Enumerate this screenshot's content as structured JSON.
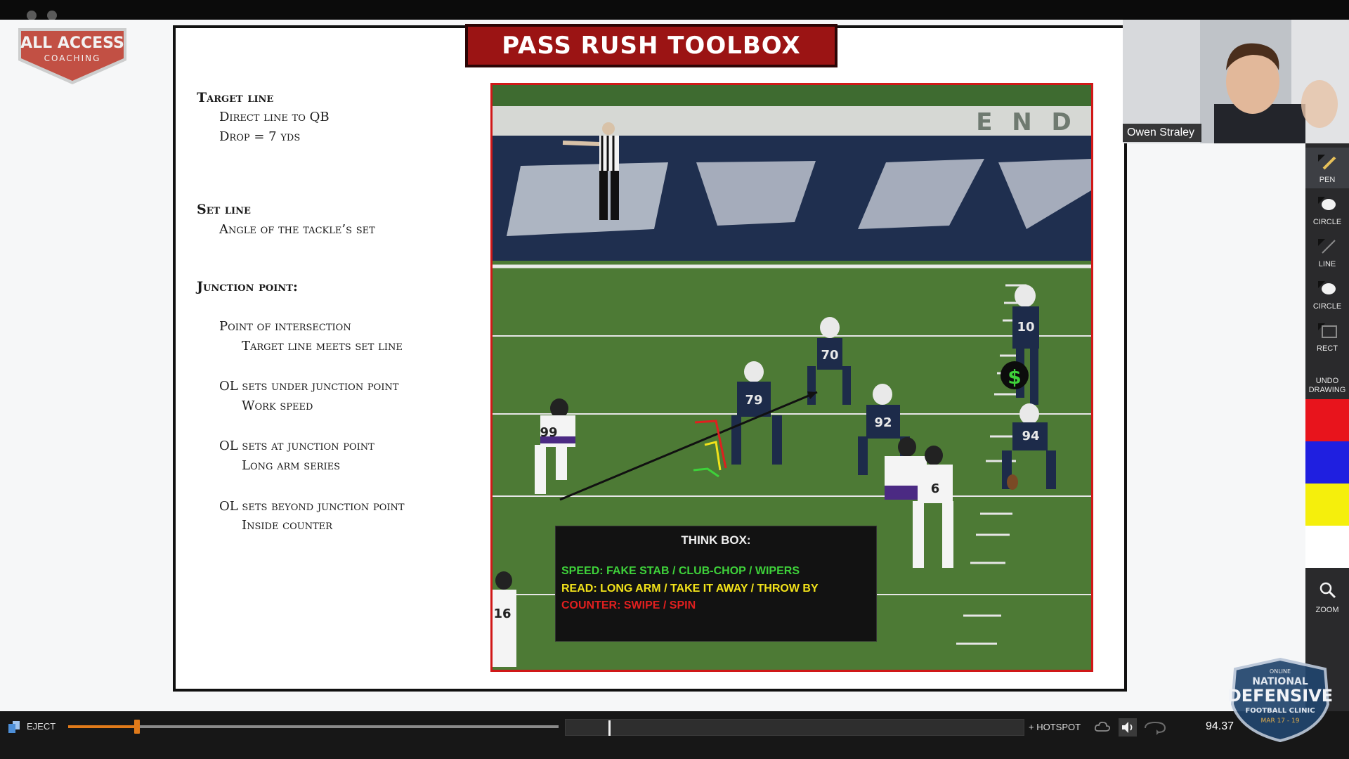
{
  "brand": {
    "logo_line1": "ALL ACCESS",
    "logo_line2": "COACHING",
    "logo_color": "#c0392b"
  },
  "slide": {
    "title": "PASS RUSH TOOLBOX",
    "title_bg": "#9b1414",
    "notes": {
      "target_line": "Target line",
      "target_sub1": "Direct line to QB",
      "target_sub2": "Drop = 7 yds",
      "set_line": "Set line",
      "set_sub1": "Angle of the tackle’s set",
      "junction": "Junction point:",
      "junction_sub1": "Point of intersection",
      "junction_sub1b": "Target line meets set line",
      "under": "OL sets under junction point",
      "under_sub": "Work speed",
      "at": "OL sets at junction point",
      "at_sub": "Long arm series",
      "beyond": "OL sets beyond junction point",
      "beyond_sub": "Inside counter"
    },
    "field": {
      "endzone_text": "E N D",
      "jersey_numbers": [
        "10",
        "70",
        "79",
        "92",
        "94",
        "99",
        "6",
        "16"
      ],
      "money_icon": "$",
      "colors": {
        "grass": "#4d7a35",
        "chargers": "#1d2b4a",
        "ravens": "#ffffff",
        "ravens_accent": "#4b2a83"
      }
    },
    "think_box": {
      "title": "THINK BOX:",
      "speed": "SPEED: FAKE STAB / CLUB-CHOP / WIPERS",
      "read": "READ: LONG ARM / TAKE IT AWAY / THROW BY",
      "counter": "COUNTER: SWIPE / SPIN",
      "speed_color": "#3ed13a",
      "read_color": "#f2e21a",
      "counter_color": "#e01f1f"
    }
  },
  "webcam": {
    "name": "Owen Straley"
  },
  "tools": {
    "items": [
      {
        "label": "PEN",
        "icon": "pen-icon"
      },
      {
        "label": "CIRCLE",
        "icon": "circle-icon"
      },
      {
        "label": "LINE",
        "icon": "line-icon"
      },
      {
        "label": "CIRCLE",
        "icon": "circle-icon"
      },
      {
        "label": "RECT",
        "icon": "rect-icon"
      }
    ],
    "undo": "UNDO DRAWING",
    "colors": [
      "#e8141c",
      "#1f1fe0",
      "#f5ef0c",
      "#ffffff"
    ],
    "zoom": "ZOOM"
  },
  "player": {
    "eject": "EJECT",
    "progress": 0.14,
    "hotspot": "+ HOTSPOT",
    "timecode": "94.37",
    "accent": "#e07a1a"
  },
  "clinic": {
    "top": "ONLINE",
    "line1": "NATIONAL",
    "line2": "DEFENSIVE",
    "line3": "FOOTBALL CLINIC",
    "dates": "MAR 17 - 19"
  }
}
